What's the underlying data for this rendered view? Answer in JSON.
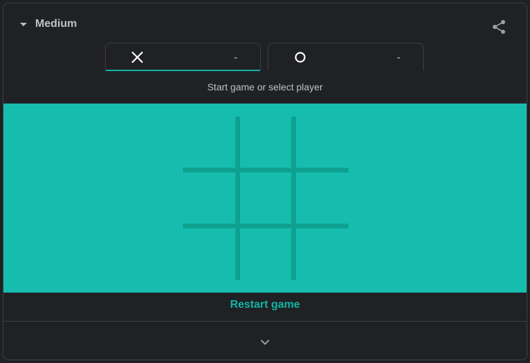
{
  "difficulty": {
    "label": "Medium"
  },
  "players": [
    {
      "mark": "X",
      "score": "-",
      "active": true
    },
    {
      "mark": "O",
      "score": "-",
      "active": false
    }
  ],
  "status_text": "Start game or select player",
  "board": {
    "cells": [
      "",
      "",
      "",
      "",
      "",
      "",
      "",
      "",
      ""
    ]
  },
  "restart_label": "Restart game",
  "icons": {
    "difficulty_toggle": "caret-down-icon",
    "share": "share-icon",
    "expand": "chevron-down-icon"
  },
  "colors": {
    "accent": "#12b5a5",
    "board_bg": "#16bdaf",
    "grid_line": "#0fa190",
    "surface": "#202124"
  }
}
